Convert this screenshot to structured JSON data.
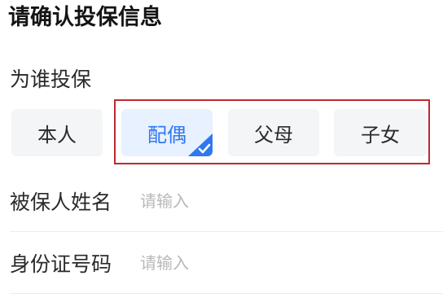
{
  "page": {
    "title": "请确认投保信息"
  },
  "insured_for": {
    "label": "为谁投保",
    "options": [
      {
        "label": "本人",
        "selected": false
      },
      {
        "label": "配偶",
        "selected": true
      },
      {
        "label": "父母",
        "selected": false
      },
      {
        "label": "子女",
        "selected": false
      }
    ]
  },
  "fields": {
    "name": {
      "label": "被保人姓名",
      "placeholder": "请输入",
      "value": ""
    },
    "id_number": {
      "label": "身份证号码",
      "placeholder": "请输入",
      "value": ""
    }
  },
  "colors": {
    "accent": "#2f78f0",
    "selected_bg": "#e8f1ff",
    "option_bg": "#f4f5f7",
    "highlight_border": "#c0282e"
  },
  "icons": {
    "selected_mark": "checkmark-corner-icon"
  }
}
